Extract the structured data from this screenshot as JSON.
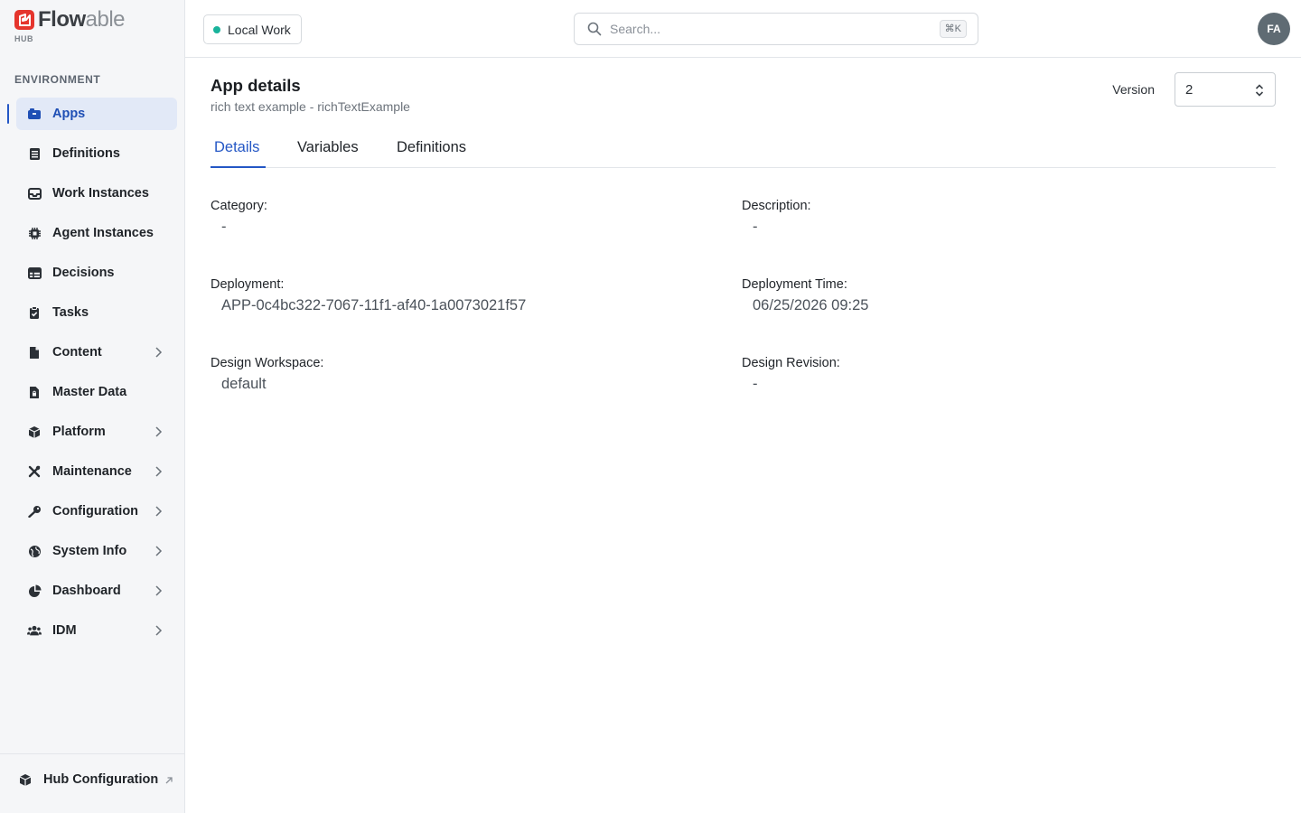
{
  "brand": {
    "name_bold": "Flow",
    "name_light": "able",
    "sub": "HUB"
  },
  "sidebar": {
    "section_title": "ENVIRONMENT",
    "items": [
      {
        "label": "Apps",
        "icon": "apps-icon",
        "active": true,
        "expandable": false
      },
      {
        "label": "Definitions",
        "icon": "book-icon",
        "active": false,
        "expandable": false
      },
      {
        "label": "Work Instances",
        "icon": "inbox-icon",
        "active": false,
        "expandable": false
      },
      {
        "label": "Agent Instances",
        "icon": "chip-icon",
        "active": false,
        "expandable": false
      },
      {
        "label": "Decisions",
        "icon": "table-icon",
        "active": false,
        "expandable": false
      },
      {
        "label": "Tasks",
        "icon": "clipboard-check-icon",
        "active": false,
        "expandable": false
      },
      {
        "label": "Content",
        "icon": "file-icon",
        "active": false,
        "expandable": true
      },
      {
        "label": "Master Data",
        "icon": "file-lock-icon",
        "active": false,
        "expandable": false
      },
      {
        "label": "Platform",
        "icon": "cube-icon",
        "active": false,
        "expandable": true
      },
      {
        "label": "Maintenance",
        "icon": "tools-icon",
        "active": false,
        "expandable": true
      },
      {
        "label": "Configuration",
        "icon": "key-icon",
        "active": false,
        "expandable": true
      },
      {
        "label": "System Info",
        "icon": "globe-icon",
        "active": false,
        "expandable": true
      },
      {
        "label": "Dashboard",
        "icon": "pie-chart-icon",
        "active": false,
        "expandable": true
      },
      {
        "label": "IDM",
        "icon": "users-icon",
        "active": false,
        "expandable": true
      }
    ],
    "footer": {
      "label": "Hub Configuration"
    }
  },
  "topbar": {
    "environment": "Local Work",
    "search_placeholder": "Search...",
    "shortcut": "⌘K",
    "avatar_initials": "FA"
  },
  "page": {
    "title": "App details",
    "subtitle": "rich text example - richTextExample",
    "version_label": "Version",
    "version_value": "2",
    "tabs": [
      "Details",
      "Variables",
      "Definitions"
    ],
    "active_tab": "Details"
  },
  "details": {
    "category": {
      "label": "Category:",
      "value": "-"
    },
    "description": {
      "label": "Description:",
      "value": "-"
    },
    "deployment": {
      "label": "Deployment:",
      "value": "APP-0c4bc322-7067-11f1-af40-1a0073021f57"
    },
    "deployment_time": {
      "label": "Deployment Time:",
      "value": "06/25/2026 09:25"
    },
    "design_workspace": {
      "label": "Design Workspace:",
      "value": "default"
    },
    "design_revision": {
      "label": "Design Revision:",
      "value": "-"
    }
  },
  "colors": {
    "accent": "#2457c5",
    "brand": "#e5352d",
    "status_dot": "#19b39b",
    "sidebar_bg": "#f5f6f8"
  }
}
